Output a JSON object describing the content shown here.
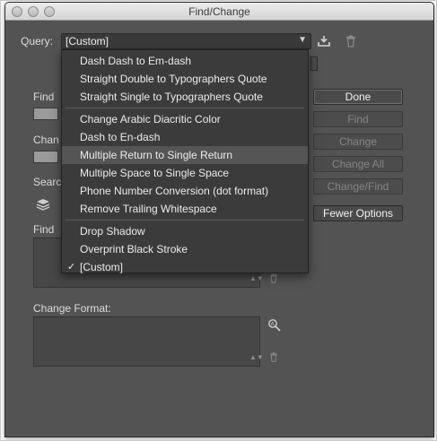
{
  "window": {
    "title": "Find/Change"
  },
  "query": {
    "label": "Query:",
    "value": "[Custom]",
    "options": [
      "Dash Dash to Em-dash",
      "Straight Double to Typographers Quote",
      "Straight Single to Typographers Quote",
      "Change Arabic Diacritic Color",
      "Dash to En-dash",
      "Multiple Return to Single Return",
      "Multiple Space to Single Space",
      "Phone Number Conversion (dot format)",
      "Remove Trailing Whitespace",
      "Drop Shadow",
      "Overprint Black Stroke",
      "[Custom]"
    ],
    "highlighted_option": "Multiple Return to Single Return",
    "selected_option": "[Custom]"
  },
  "labels": {
    "find_partial": "Find",
    "change_partial": "Chan",
    "search_partial": "Searc",
    "find_format_partial": "Find",
    "change_format": "Change Format:"
  },
  "buttons": {
    "done": "Done",
    "find": "Find",
    "change": "Change",
    "change_all": "Change All",
    "change_find": "Change/Find",
    "fewer_options": "Fewer Options"
  },
  "icons": {
    "check": "✓",
    "dropdown_arrow": "▼",
    "save_query": "⬇",
    "delete_query": "🗑",
    "trash": "🗑",
    "format_specify": "A"
  }
}
